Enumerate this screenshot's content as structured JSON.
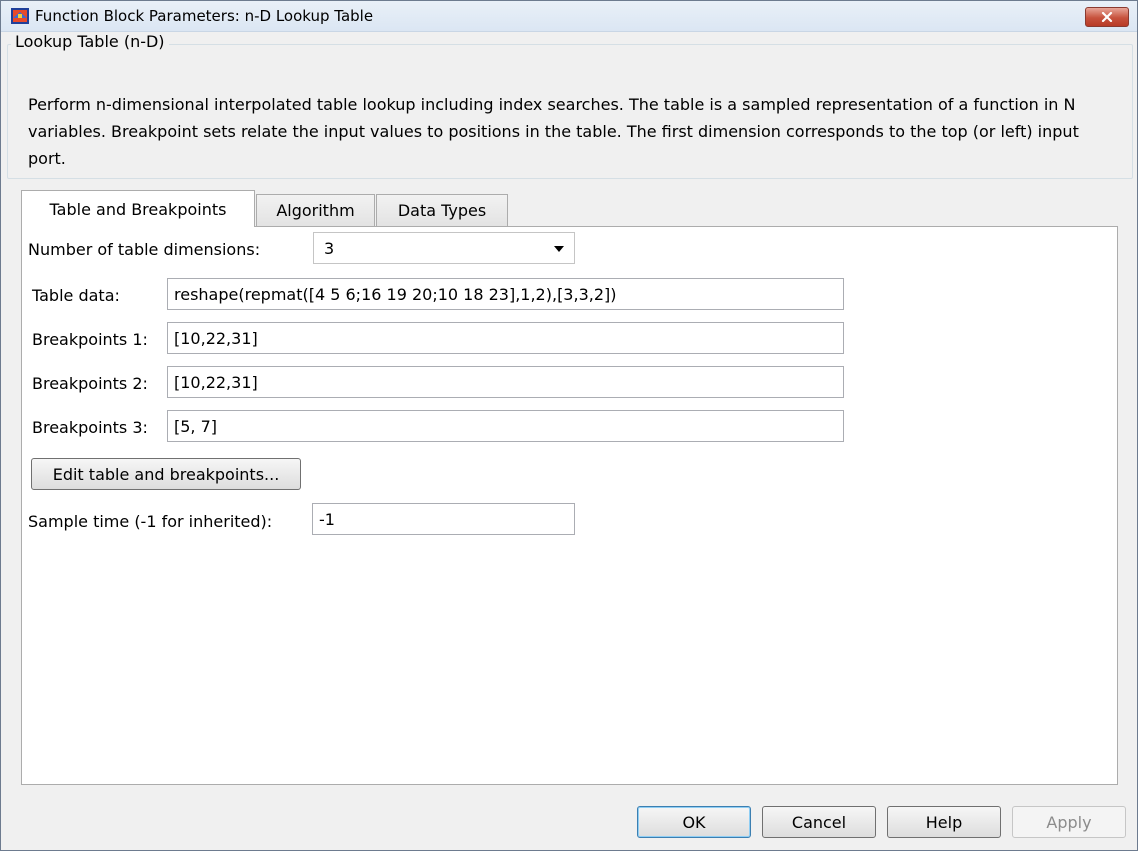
{
  "window": {
    "title": "Function Block Parameters: n-D Lookup Table",
    "close_icon": "close-icon"
  },
  "block": {
    "group_title": "Lookup Table (n-D)",
    "description": "Perform n-dimensional interpolated table lookup including index searches. The table is a sampled representation of a function in N variables. Breakpoint sets relate the input values to positions in the table. The first dimension corresponds to the top (or left) input port."
  },
  "tabs": [
    {
      "label": "Table and Breakpoints",
      "active": true
    },
    {
      "label": "Algorithm",
      "active": false
    },
    {
      "label": "Data Types",
      "active": false
    }
  ],
  "params": {
    "num_dims_label": "Number of table dimensions:",
    "num_dims_value": "3",
    "table_data_label": "Table data:",
    "table_data_value": "reshape(repmat([4 5 6;16 19 20;10 18 23],1,2),[3,3,2])",
    "bp1_label": "Breakpoints 1:",
    "bp1_value": "[10,22,31]",
    "bp2_label": "Breakpoints 2:",
    "bp2_value": "[10,22,31]",
    "bp3_label": "Breakpoints 3:",
    "bp3_value": "[5, 7]",
    "edit_button": "Edit table and breakpoints...",
    "sample_time_label": "Sample time (-1 for inherited):",
    "sample_time_value": "-1"
  },
  "buttons": {
    "ok": "OK",
    "cancel": "Cancel",
    "help": "Help",
    "apply": "Apply"
  },
  "colors": {
    "close_button": "#c7523d",
    "window_bg": "#f0f0f0",
    "panel_bg": "#ffffff"
  }
}
